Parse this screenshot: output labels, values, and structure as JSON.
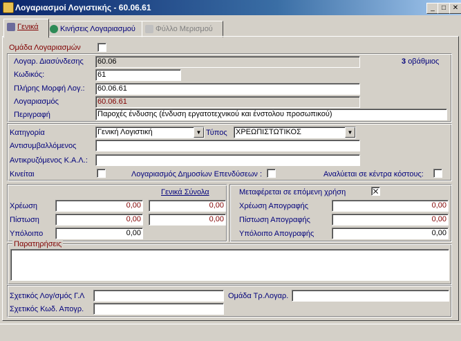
{
  "window": {
    "title": "Λογαριασμοί Λογιστικής - 60.06.61",
    "min": "_",
    "max": "□",
    "close": "✕"
  },
  "tabs": [
    {
      "label": "Γενικά"
    },
    {
      "label": "Κινήσεις Λογαριασμού"
    },
    {
      "label": "Φύλλο Μερισμού"
    }
  ],
  "group_accounts": {
    "label": "Ομάδα Λογαριασμών",
    "checked": false
  },
  "fields": {
    "link_account": {
      "label": "Λογαρ. Διασύνδεσης",
      "value": "60.06"
    },
    "level": {
      "number": "3",
      "text": "οβάθμιος"
    },
    "code": {
      "label": "Κωδικός:",
      "value": "61"
    },
    "full_form": {
      "label": "Πλήρης Μορφή Λογ.:",
      "value": "60.06.61"
    },
    "account": {
      "label": "Λογαριασμός",
      "value": "60.06.61"
    },
    "description": {
      "label": "Περιγραφή",
      "value": "Παροχές ένδυσης (ένδυση εργατοτεχνικού και ένστολου προσωπικού)"
    }
  },
  "classification": {
    "category": {
      "label": "Κατηγορία",
      "value": "Γενική Λογιστική"
    },
    "type": {
      "label": "Τύπος",
      "value": "ΧΡΕΩΠΙΣΤΩΤΙΚΟΣ"
    },
    "counter_offset": {
      "label": "Αντισυμβαλλόμενος",
      "value": ""
    },
    "counter_kal": {
      "label": "Αντικρυζόμενος Κ.Α.Λ.:",
      "value": ""
    },
    "locked": {
      "label": "Κινείται",
      "checked": false
    },
    "public_invest": {
      "label": "Λογαριασμός Δημοσίων Επενδύσεων :",
      "checked": false
    },
    "cost_centers": {
      "label": "Αναλύεται σε κέντρα κόστους:",
      "checked": false
    }
  },
  "totals": {
    "header": "Γενικά Σύνολα",
    "debit": {
      "label": "Χρέωση",
      "value": "0,00",
      "general": "0,00"
    },
    "credit": {
      "label": "Πίστωση",
      "value": "0,00",
      "general": "0,00"
    },
    "balance": {
      "label": "Υπόλοιπο",
      "value": "0,00"
    }
  },
  "inventory": {
    "carry_over": {
      "label": "Μεταφέρεται σε επόμενη χρήση",
      "checked": true
    },
    "debit": {
      "label": "Χρέωση Απογραφής",
      "value": "0,00"
    },
    "credit": {
      "label": "Πίστωση Απογραφής",
      "value": "0,00"
    },
    "balance": {
      "label": "Υπόλοιπο Απογραφής",
      "value": "0,00"
    }
  },
  "notes": {
    "label": "Παρατηρήσεις",
    "value": ""
  },
  "related": {
    "gl_account": {
      "label": "Σχετικός Λογ/σμός Γ.Λ",
      "value": ""
    },
    "trial_group": {
      "label": "Ομάδα Τρ.Λογαρ.",
      "value": ""
    },
    "inventory_code": {
      "label": "Σχετικός Κωδ. Απογρ.",
      "value": ""
    }
  }
}
